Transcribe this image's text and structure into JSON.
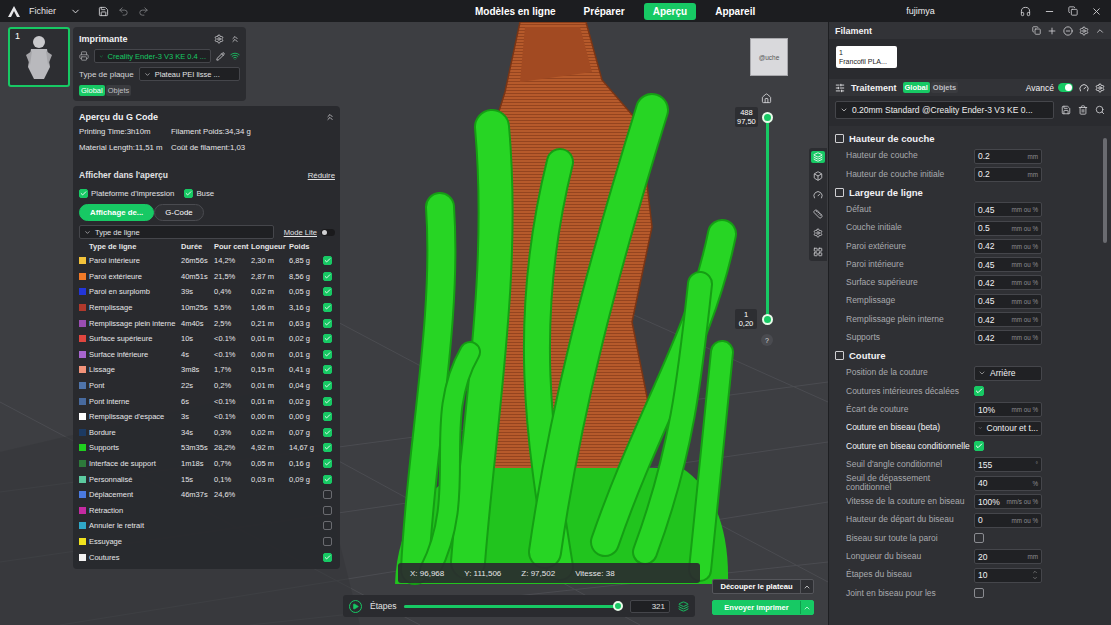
{
  "top_bar": {
    "menu": "Fichier",
    "tabs": [
      {
        "label": "Modèles en ligne",
        "selected": false
      },
      {
        "label": "Préparer",
        "selected": false
      },
      {
        "label": "Aperçu",
        "selected": true
      },
      {
        "label": "Appareil",
        "selected": false
      }
    ],
    "user": "fujimya"
  },
  "plate": {
    "number": "1"
  },
  "printer": {
    "title": "Imprimante",
    "name": "Creality Ender-3 V3 KE 0.4 ...",
    "plate_type_label": "Type de plaque",
    "plate_type": "Plateau PEI lisse ...",
    "scope_tabs": [
      {
        "label": "Global",
        "selected": true
      },
      {
        "label": "Objets",
        "selected": false
      }
    ]
  },
  "gcode": {
    "title": "Aperçu du G Code",
    "stats": [
      "Printing Time:3h10m",
      "Filament Poids:34,34 g",
      "Material Length:11,51 m",
      "Coût de filament:1,03"
    ],
    "show_title": "Afficher dans l'aperçu",
    "collapse": "Réduire",
    "toggles": [
      {
        "label": "Plateforme d'impression",
        "checked": true
      },
      {
        "label": "Buse",
        "checked": true
      }
    ],
    "view_tabs": [
      {
        "label": "Affichage de...",
        "selected": true
      },
      {
        "label": "G-Code",
        "selected": false
      }
    ],
    "lite_mode": {
      "label": "Mode Lite",
      "on": false
    },
    "line_type_select": "Type de ligne",
    "columns": [
      "Type de ligne",
      "Durée",
      "Pour cent",
      "Longueur",
      "Poids"
    ],
    "rows": [
      {
        "name": "Paroi intérieure",
        "time": "26m56s",
        "percent": "14,2%",
        "length": "2,30 m",
        "weight": "6,85 g",
        "color": "#f2c23a",
        "checked": true
      },
      {
        "name": "Paroi extérieure",
        "time": "40m51s",
        "percent": "21,5%",
        "length": "2,87 m",
        "weight": "8,56 g",
        "color": "#f07a28",
        "checked": true
      },
      {
        "name": "Paroi en surplomb",
        "time": "39s",
        "percent": "0,4%",
        "length": "0,02 m",
        "weight": "0,05 g",
        "color": "#2336d8",
        "checked": true
      },
      {
        "name": "Remplissage",
        "time": "10m25s",
        "percent": "5,5%",
        "length": "1,06 m",
        "weight": "3,16 g",
        "color": "#b0392c",
        "checked": true
      },
      {
        "name": "Remplissage plein interne",
        "time": "4m40s",
        "percent": "2,5%",
        "length": "0,21 m",
        "weight": "0,63 g",
        "color": "#9a4db2",
        "checked": true
      },
      {
        "name": "Surface supérieure",
        "time": "10s",
        "percent": "<0.1%",
        "length": "0,01 m",
        "weight": "0,02 g",
        "color": "#e0463f",
        "checked": true
      },
      {
        "name": "Surface inférieure",
        "time": "4s",
        "percent": "<0.1%",
        "length": "0,00 m",
        "weight": "0,01 g",
        "color": "#a865cf",
        "checked": true
      },
      {
        "name": "Lissage",
        "time": "3m8s",
        "percent": "1,7%",
        "length": "0,15 m",
        "weight": "0,41 g",
        "color": "#f2937a",
        "checked": true
      },
      {
        "name": "Pont",
        "time": "22s",
        "percent": "0,2%",
        "length": "0,01 m",
        "weight": "0,04 g",
        "color": "#4f74aa",
        "checked": true
      },
      {
        "name": "Pont interne",
        "time": "6s",
        "percent": "<0.1%",
        "length": "0,01 m",
        "weight": "0,02 g",
        "color": "#476a9f",
        "checked": true
      },
      {
        "name": "Remplissage d'espace",
        "time": "3s",
        "percent": "<0.1%",
        "length": "0,00 m",
        "weight": "0,00 g",
        "color": "#ffffff",
        "checked": true
      },
      {
        "name": "Bordure",
        "time": "34s",
        "percent": "0,3%",
        "length": "0,02 m",
        "weight": "0,07 g",
        "color": "#1c3a62",
        "checked": true
      },
      {
        "name": "Supports",
        "time": "53m35s",
        "percent": "28,2%",
        "length": "4,92 m",
        "weight": "14,67 g",
        "color": "#1fd01f",
        "checked": true
      },
      {
        "name": "Interface de support",
        "time": "1m18s",
        "percent": "0,7%",
        "length": "0,05 m",
        "weight": "0,16 g",
        "color": "#2d7a3a",
        "checked": true
      },
      {
        "name": "Personnalisé",
        "time": "15s",
        "percent": "0,1%",
        "length": "0,03 m",
        "weight": "0,09 g",
        "color": "#5ccaa0",
        "checked": true
      },
      {
        "name": "Déplacement",
        "time": "46m37s",
        "percent": "24,6%",
        "color": "#4a7ae0",
        "checked": false
      },
      {
        "name": "Rétraction",
        "color": "#c42aa2",
        "checked": false
      },
      {
        "name": "Annuler le retrait",
        "color": "#2fa8c8",
        "checked": false
      },
      {
        "name": "Essuyage",
        "color": "#f0e21e",
        "checked": false
      },
      {
        "name": "Coutures",
        "color": "#f2f2f2",
        "checked": true
      }
    ]
  },
  "viewport": {
    "view_cube": [
      "@uche"
    ],
    "layer_top": {
      "layer": "488",
      "height": "97,50",
      "level": 1
    },
    "layer_bottom": {
      "layer": "1",
      "height": "0,20",
      "level": 0
    },
    "help": "?",
    "readout": [
      "X: 96,968",
      "Y: 111,506",
      "Z: 97,502",
      "Vitesse: 38"
    ],
    "steps": {
      "label": "Étapes",
      "value": "321",
      "level": 0.98
    },
    "buttons": [
      "Découper le plateau",
      "Envoyer imprimer"
    ]
  },
  "sidebar": {
    "filament": {
      "title": "Filament",
      "items": [
        {
          "number": "1",
          "name": "Francofil PLA..."
        }
      ]
    },
    "process": {
      "title": "Traitement",
      "scope_tabs": [
        {
          "label": "Global",
          "selected": true
        },
        {
          "label": "Objets",
          "selected": false
        }
      ],
      "advanced": {
        "label": "Avancé",
        "on": true
      },
      "profile": "0.20mm Standard @Creality Ender-3 V3 KE 0..."
    },
    "sections": [
      {
        "title": "Hauteur de couche",
        "settings": [
          {
            "kind": "input",
            "label": "Hauteur de couche",
            "value": "0.2",
            "unit": "mm",
            "highlight": false
          },
          {
            "kind": "input",
            "label": "Hauteur de couche initiale",
            "value": "0.2",
            "unit": "mm",
            "highlight": false
          }
        ]
      },
      {
        "title": "Largeur de ligne",
        "settings": [
          {
            "kind": "input",
            "label": "Défaut",
            "value": "0.45",
            "unit": "mm ou %",
            "highlight": false
          },
          {
            "kind": "input",
            "label": "Couche initiale",
            "value": "0.5",
            "unit": "mm ou %",
            "highlight": false
          },
          {
            "kind": "input",
            "label": "Paroi extérieure",
            "value": "0.42",
            "unit": "mm ou %",
            "highlight": false
          },
          {
            "kind": "input",
            "label": "Paroi intérieure",
            "value": "0.45",
            "unit": "mm ou %",
            "highlight": false
          },
          {
            "kind": "input",
            "label": "Surface supérieure",
            "value": "0.42",
            "unit": "mm ou %",
            "highlight": false
          },
          {
            "kind": "input",
            "label": "Remplissage",
            "value": "0.45",
            "unit": "mm ou %",
            "highlight": false
          },
          {
            "kind": "input",
            "label": "Remplissage plein interne",
            "value": "0.42",
            "unit": "mm ou %",
            "highlight": false
          },
          {
            "kind": "input",
            "label": "Supports",
            "value": "0.42",
            "unit": "mm ou %",
            "highlight": false
          }
        ]
      },
      {
        "title": "Couture",
        "settings": [
          {
            "kind": "select",
            "label": "Position de la couture",
            "value": "Arrière",
            "highlight": false
          },
          {
            "kind": "checkbox",
            "label": "Coutures intérieures décalées",
            "checked": true,
            "highlight": false
          },
          {
            "kind": "input",
            "label": "Écart de couture",
            "value": "10%",
            "unit": "mm ou %",
            "highlight": false
          },
          {
            "kind": "select",
            "label": "Couture en biseau (beta)",
            "value": "Contour et t...",
            "highlight": true
          },
          {
            "kind": "checkbox",
            "label": "Couture en biseau conditionnelle",
            "checked": true,
            "highlight": true
          },
          {
            "kind": "input",
            "label": "Seuil d'angle conditionnel",
            "value": "155",
            "unit": "°",
            "highlight": false
          },
          {
            "kind": "input",
            "label": "Seuil de dépassement conditionnel",
            "value": "40",
            "unit": "%",
            "highlight": false
          },
          {
            "kind": "input",
            "label": "Vitesse de la couture en biseau",
            "value": "100%",
            "unit": "mm/s ou %",
            "highlight": false
          },
          {
            "kind": "input",
            "label": "Hauteur de départ du biseau",
            "value": "0",
            "unit": "mm ou %",
            "highlight": false
          },
          {
            "kind": "checkbox",
            "label": "Biseau sur toute la paroi",
            "checked": false,
            "highlight": false
          },
          {
            "kind": "input",
            "label": "Longueur du biseau",
            "value": "20",
            "unit": "mm",
            "highlight": false
          },
          {
            "kind": "spin",
            "label": "Étapes du biseau",
            "value": "10",
            "highlight": false
          },
          {
            "kind": "checkbox",
            "label": "Joint en biseau pour les",
            "checked": false,
            "highlight": false
          }
        ]
      }
    ]
  }
}
